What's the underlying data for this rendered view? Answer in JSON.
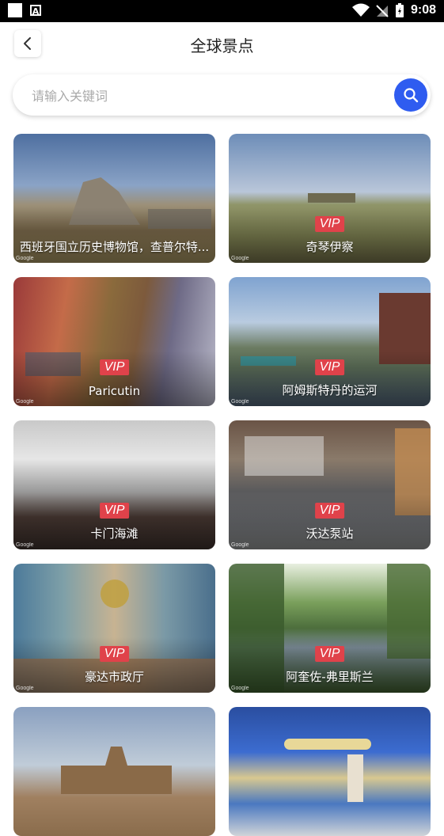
{
  "status_bar": {
    "time": "9:08"
  },
  "header": {
    "title": "全球景点"
  },
  "search": {
    "placeholder": "请输入关键词"
  },
  "places": [
    {
      "name": "西班牙国立历史博物馆，查普尔特...",
      "vip": false
    },
    {
      "name": "奇琴伊察",
      "vip": true
    },
    {
      "name": "Paricutin",
      "vip": true
    },
    {
      "name": "阿姆斯特丹的运河",
      "vip": true
    },
    {
      "name": "卡门海滩",
      "vip": true
    },
    {
      "name": "沃达泵站",
      "vip": true
    },
    {
      "name": "豪达市政厅",
      "vip": true
    },
    {
      "name": "阿奎佐-弗里斯兰",
      "vip": true
    },
    {
      "name": "",
      "vip": false
    },
    {
      "name": "",
      "vip": false
    }
  ],
  "vip_label": "VIP",
  "watermark": "Google",
  "colors": {
    "accent": "#2f5cf0",
    "vip": "#e0424a"
  }
}
